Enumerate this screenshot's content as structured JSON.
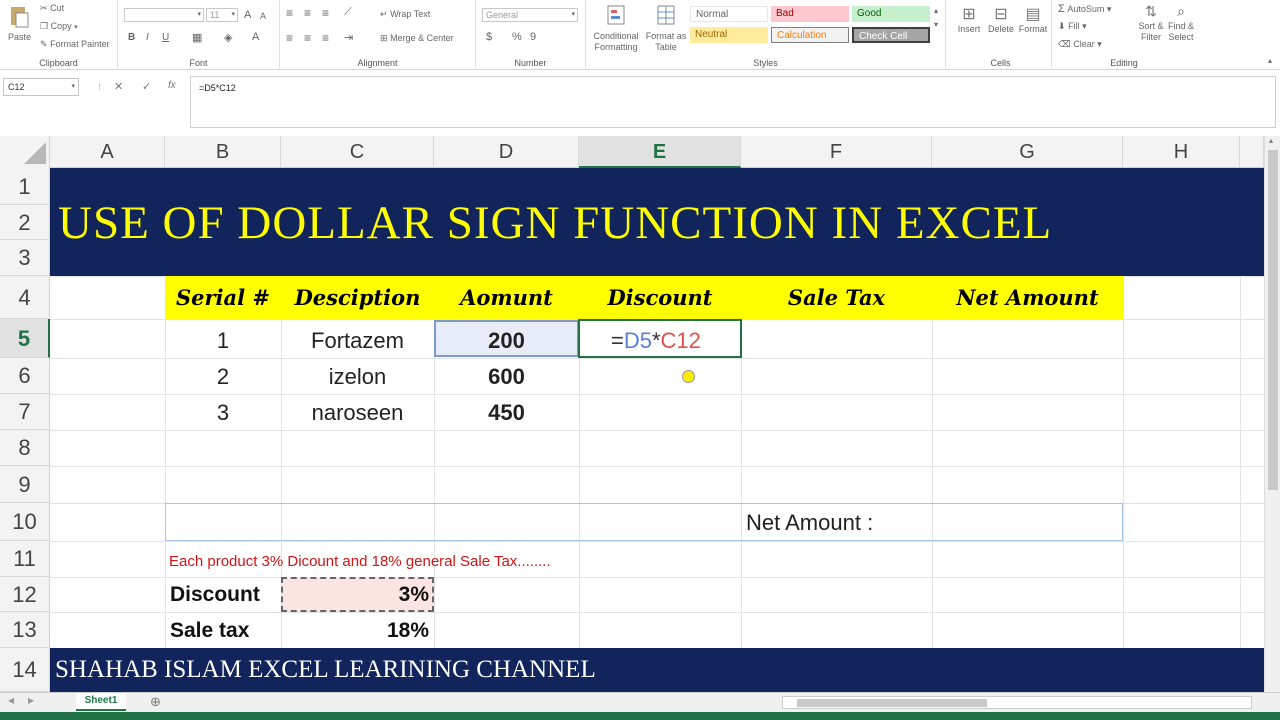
{
  "ribbon": {
    "clipboard": {
      "paste": "Paste",
      "cut": "Cut",
      "copy": "Copy",
      "format_painter": "Format Painter",
      "label": "Clipboard"
    },
    "font": {
      "font_size": "11",
      "bold": "B",
      "italic": "I",
      "underline": "U",
      "label": "Font"
    },
    "alignment": {
      "wrap_text": "Wrap Text",
      "merge_center": "Merge & Center",
      "label": "Alignment"
    },
    "number": {
      "format": "General",
      "currency": "$",
      "percent": "%",
      "comma": "9",
      "label": "Number"
    },
    "styles": {
      "conditional_formatting": "Conditional Formatting",
      "format_as_table": "Format as Table",
      "normal": "Normal",
      "bad": "Bad",
      "good": "Good",
      "neutral": "Neutral",
      "calculation": "Calculation",
      "check_cell": "Check Cell",
      "label": "Styles"
    },
    "cells": {
      "insert": "Insert",
      "delete": "Delete",
      "format": "Format",
      "label": "Cells"
    },
    "editing": {
      "autosum": "AutoSum",
      "fill": "Fill",
      "clear": "Clear",
      "sort_filter": "Sort & Filter",
      "find_select": "Find & Select",
      "label": "Editing"
    }
  },
  "formula_bar": {
    "name_box": "C12",
    "cancel": "✕",
    "enter": "✓",
    "fx": "fx",
    "formula": "=D5*C12"
  },
  "columns": [
    "A",
    "B",
    "C",
    "D",
    "E",
    "F",
    "G",
    "H"
  ],
  "active_column": "E",
  "rows": [
    "1",
    "2",
    "3",
    "4",
    "5",
    "6",
    "7",
    "8",
    "9",
    "10",
    "11",
    "12",
    "13",
    "14"
  ],
  "active_row": "5",
  "sheet": {
    "title": "USE OF DOLLAR SIGN FUNCTION IN EXCEL",
    "headers": [
      "Serial #",
      "Desciption",
      "Aomunt",
      "Discount",
      "Sale Tax",
      "Net Amount"
    ],
    "rows": [
      {
        "serial": "1",
        "description": "Fortazem",
        "amount": "200"
      },
      {
        "serial": "2",
        "description": "izelon",
        "amount": "600"
      },
      {
        "serial": "3",
        "description": "naroseen",
        "amount": "450"
      }
    ],
    "editing_cell": {
      "eq": "=",
      "ref1": "D5",
      "op": "*",
      "ref2": "C12"
    },
    "net_amount_label": "Net Amount :",
    "note": "Each product 3% Dicount and 18% general Sale Tax........",
    "discount_label": "Discount",
    "discount_value": "3%",
    "sale_tax_label": "Sale tax",
    "sale_tax_value": "18%",
    "footer": "SHAHAB ISLAM EXCEL LEARINING CHANNEL"
  },
  "tabs": {
    "sheet1": "Sheet1",
    "add": "⊕"
  },
  "colors": {
    "banner": "#11245b",
    "title": "#ffff00",
    "header_fill": "#ffff00",
    "accent": "#217346",
    "note": "#d01414"
  }
}
